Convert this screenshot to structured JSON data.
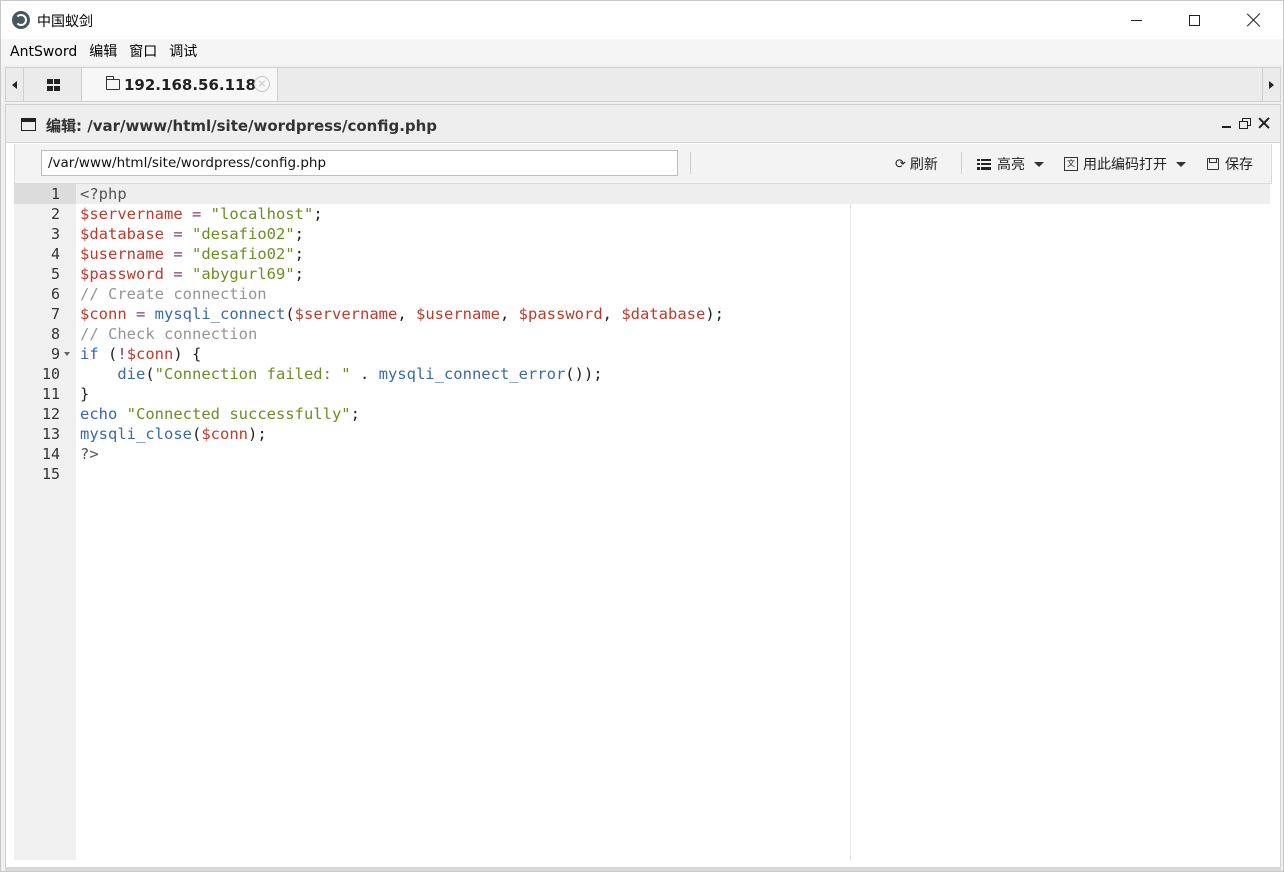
{
  "app": {
    "title": "中国蚁剑"
  },
  "menu": [
    "AntSword",
    "编辑",
    "窗口",
    "调试"
  ],
  "tabs": {
    "host_tab": "192.168.56.118"
  },
  "panel": {
    "title": "编辑: /var/www/html/site/wordpress/config.php"
  },
  "toolbar": {
    "path_value": "/var/www/html/site/wordpress/config.php",
    "refresh": "刷新",
    "highlight": "高亮",
    "open_with_encoding": "用此编码打开",
    "save": "保存"
  },
  "editor": {
    "lines": [
      [
        {
          "t": "<?php",
          "c": "tag"
        }
      ],
      [
        {
          "t": "$servername",
          "c": "var"
        },
        {
          "t": " = ",
          "c": "op"
        },
        {
          "t": "\"localhost\"",
          "c": "str"
        },
        {
          "t": ";",
          "c": "plain"
        }
      ],
      [
        {
          "t": "$database",
          "c": "var"
        },
        {
          "t": " = ",
          "c": "op"
        },
        {
          "t": "\"desafio02\"",
          "c": "str"
        },
        {
          "t": ";",
          "c": "plain"
        }
      ],
      [
        {
          "t": "$username",
          "c": "var"
        },
        {
          "t": " = ",
          "c": "op"
        },
        {
          "t": "\"desafio02\"",
          "c": "str"
        },
        {
          "t": ";",
          "c": "plain"
        }
      ],
      [
        {
          "t": "$password",
          "c": "var"
        },
        {
          "t": " = ",
          "c": "op"
        },
        {
          "t": "\"abygurl69\"",
          "c": "str"
        },
        {
          "t": ";",
          "c": "plain"
        }
      ],
      [
        {
          "t": "// Create connection",
          "c": "com"
        }
      ],
      [
        {
          "t": "$conn",
          "c": "var"
        },
        {
          "t": " = ",
          "c": "op"
        },
        {
          "t": "mysqli_connect",
          "c": "fn"
        },
        {
          "t": "(",
          "c": "plain"
        },
        {
          "t": "$servername",
          "c": "var"
        },
        {
          "t": ", ",
          "c": "plain"
        },
        {
          "t": "$username",
          "c": "var"
        },
        {
          "t": ", ",
          "c": "plain"
        },
        {
          "t": "$password",
          "c": "var"
        },
        {
          "t": ", ",
          "c": "plain"
        },
        {
          "t": "$database",
          "c": "var"
        },
        {
          "t": ");",
          "c": "plain"
        }
      ],
      [
        {
          "t": "// Check connection",
          "c": "com"
        }
      ],
      [
        {
          "t": "if",
          "c": "kw"
        },
        {
          "t": " (",
          "c": "plain"
        },
        {
          "t": "!",
          "c": "op"
        },
        {
          "t": "$conn",
          "c": "var"
        },
        {
          "t": ") {",
          "c": "plain"
        }
      ],
      [
        {
          "t": "    ",
          "c": "plain"
        },
        {
          "t": "die",
          "c": "fn"
        },
        {
          "t": "(",
          "c": "plain"
        },
        {
          "t": "\"Connection failed: \"",
          "c": "str"
        },
        {
          "t": " . ",
          "c": "plain"
        },
        {
          "t": "mysqli_connect_error",
          "c": "fn"
        },
        {
          "t": "());",
          "c": "plain"
        }
      ],
      [
        {
          "t": "}",
          "c": "plain"
        }
      ],
      [
        {
          "t": "echo",
          "c": "kw"
        },
        {
          "t": " ",
          "c": "plain"
        },
        {
          "t": "\"Connected successfully\"",
          "c": "str"
        },
        {
          "t": ";",
          "c": "plain"
        }
      ],
      [
        {
          "t": "mysqli_close",
          "c": "fn"
        },
        {
          "t": "(",
          "c": "plain"
        },
        {
          "t": "$conn",
          "c": "var"
        },
        {
          "t": ");",
          "c": "plain"
        }
      ],
      [
        {
          "t": "?>",
          "c": "tag"
        }
      ],
      []
    ],
    "fold_line": 9
  }
}
